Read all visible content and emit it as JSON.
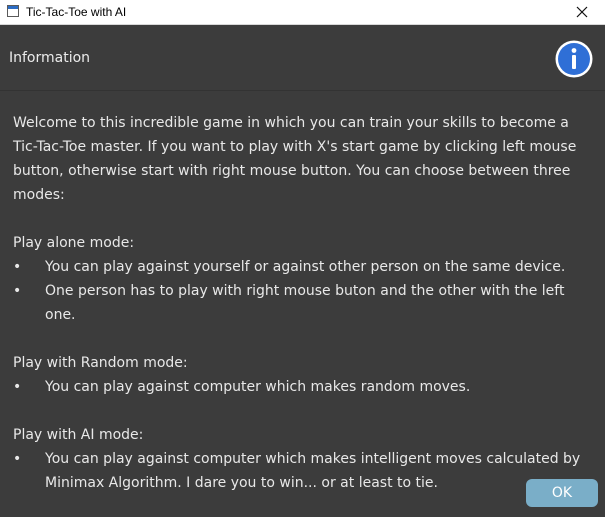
{
  "window": {
    "title": "Tic-Tac-Toe with AI"
  },
  "dialog": {
    "header": "Information",
    "intro": "Welcome to this incredible game in which you can train your skills to become a Tic-Tac-Toe master. If you want to play with X's start game by clicking left mouse button, otherwise start with right mouse button.  You can choose between three modes:",
    "bullet_char": "•",
    "modes": [
      {
        "title": "Play alone mode:",
        "bullets": [
          "You can play against yourself or against other person on the same device.",
          "One person has to play with right mouse buton and the other with the left one."
        ]
      },
      {
        "title": "Play with Random mode:",
        "bullets": [
          "You can play against computer which makes random moves."
        ]
      },
      {
        "title": "Play with AI mode:",
        "bullets": [
          "You can play against computer which makes intelligent moves calculated by Minimax Algorithm. I dare you to win... or at least to tie."
        ]
      }
    ],
    "ok_label": "OK"
  },
  "colors": {
    "background": "#3c3c3c",
    "text": "#e8e8e8",
    "ok_button": "#7aaec8",
    "info_icon": "#2f6fd6"
  },
  "icons": {
    "app": "window-app-icon",
    "close": "close-icon",
    "info": "info-icon"
  }
}
